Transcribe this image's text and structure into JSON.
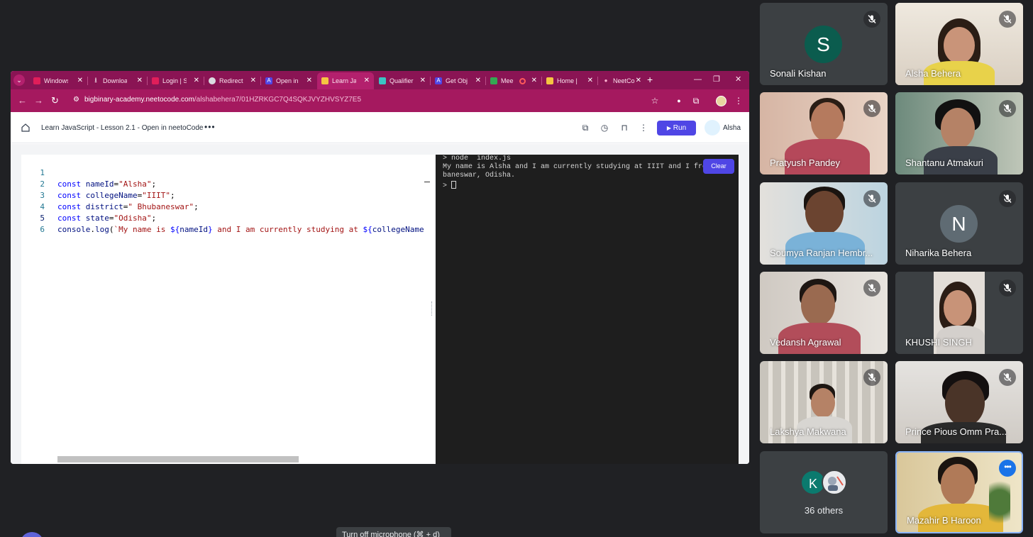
{
  "browser": {
    "tabs": [
      {
        "label": "Windows",
        "fav_color": "#e01e5a"
      },
      {
        "label": "Downloads",
        "fav_color": "#ffffff"
      },
      {
        "label": "Login | S",
        "fav_color": "#e01e5a"
      },
      {
        "label": "Redirecting",
        "fav_color": "#dadce0"
      },
      {
        "label": "Open in",
        "fav_color": "#4f46e5"
      },
      {
        "label": "Learn Ja",
        "fav_color": "#f5c542"
      },
      {
        "label": "Qualifier",
        "fav_color": "#3bc4c4"
      },
      {
        "label": "Get Obj",
        "fav_color": "#4f46e5"
      },
      {
        "label": "Mee",
        "fav_color": "#34a853"
      },
      {
        "label": "Home |",
        "fav_color": "#f5c542"
      },
      {
        "label": "NeetCo",
        "fav_color": "#ffb3d1"
      }
    ],
    "active_tab_index": 5,
    "url_host": "bigbinary-academy.neetocode.com",
    "url_path": "/alshabehera7/01HZRKGC7Q4SQKJVYZHVSYZ7E5"
  },
  "app": {
    "lesson_title": "Learn JavaScript - Lesson 2.1 - Open in neetoCode",
    "more": "•••",
    "run_label": "Run",
    "user_name": "Alsha"
  },
  "editor": {
    "line_numbers": [
      "1",
      "2",
      "3",
      "4",
      "5",
      "6"
    ],
    "lines": [
      "const nameId=\"Alsha\";",
      "const collegeName=\"IIIT\";",
      "const district=\" Bhubaneswar\";",
      "const state=\"Odisha\";",
      "console.log(`My name is ${nameId} and I am currently studying at ${collegeName",
      ""
    ]
  },
  "terminal": {
    "lines": [
      "> node  index.js",
      "My name is Alsha and I am currently studying at IIIT and I from Bhu",
      "baneswar, Odisha.",
      "> "
    ],
    "clear_label": "Clear"
  },
  "participants": [
    {
      "name": "Sonali Kishan",
      "initial": "S",
      "avatar_color": "#0b5c4e"
    },
    {
      "name": "Alsha Behera"
    },
    {
      "name": "Pratyush Pandey"
    },
    {
      "name": "Shantanu Atmakuri"
    },
    {
      "name": "Soumya Ranjan Hembr..."
    },
    {
      "name": "Niharika Behera",
      "initial": "N",
      "avatar_color": "#5f6b73"
    },
    {
      "name": "Vedansh Agrawal"
    },
    {
      "name": "KHUSHI SINGH"
    },
    {
      "name": "Lakshya Makwana"
    },
    {
      "name": "Prince Pious Omm Pra..."
    },
    {
      "others_initial": "K",
      "others_label": "36 others"
    },
    {
      "name": "Mazahir B Haroon"
    }
  ],
  "tooltip": "Turn off microphone (⌘ + d)"
}
